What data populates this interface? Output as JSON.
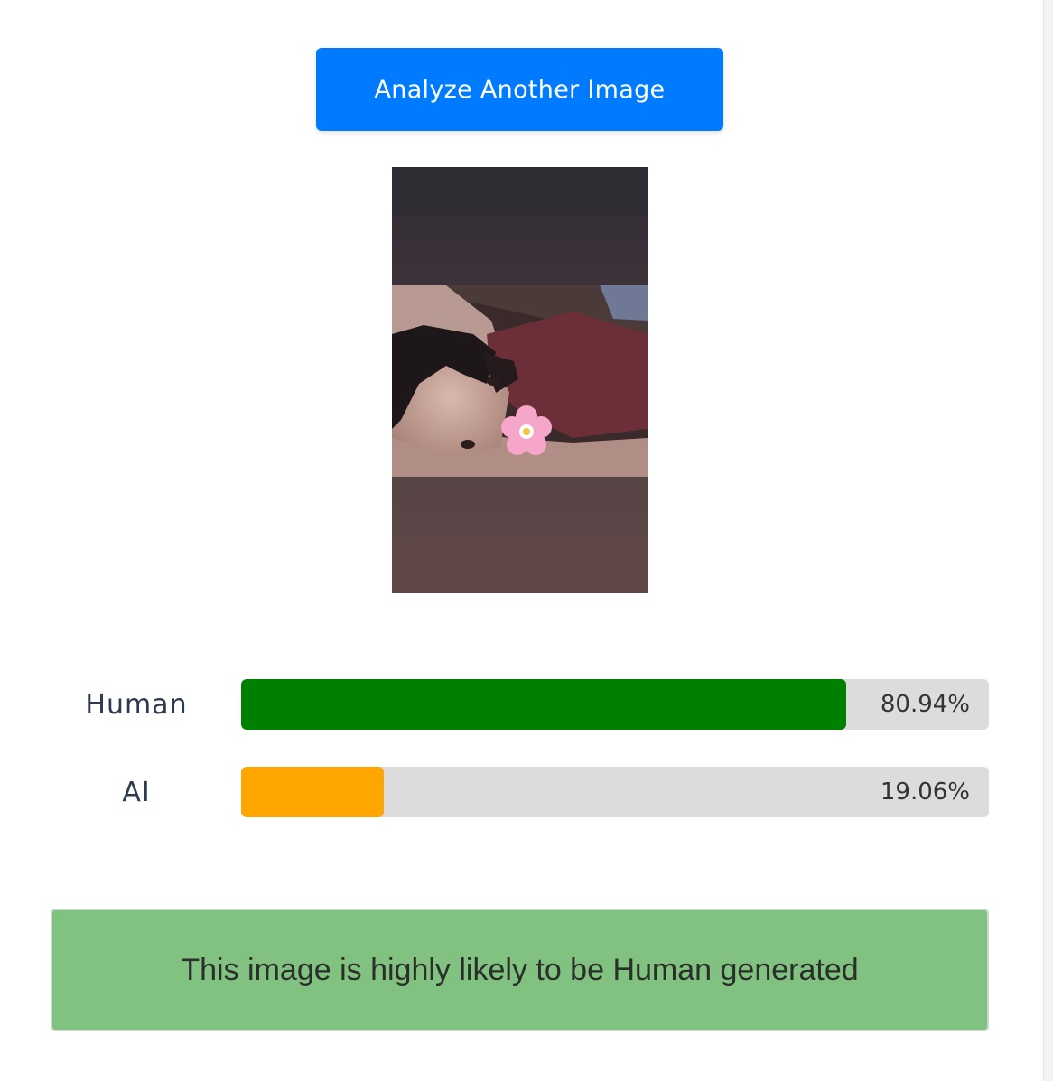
{
  "actions": {
    "analyze_another_label": "Analyze Another Image"
  },
  "preview": {
    "kind": "uploaded-photo"
  },
  "results": [
    {
      "label": "Human",
      "value": 80.94,
      "value_text": "80.94%",
      "color": "#008000"
    },
    {
      "label": "AI",
      "value": 19.06,
      "value_text": "19.06%",
      "color": "#ffa500"
    }
  ],
  "verdict": {
    "text": "This image is highly likely to be Human generated",
    "background": "#81c281"
  }
}
